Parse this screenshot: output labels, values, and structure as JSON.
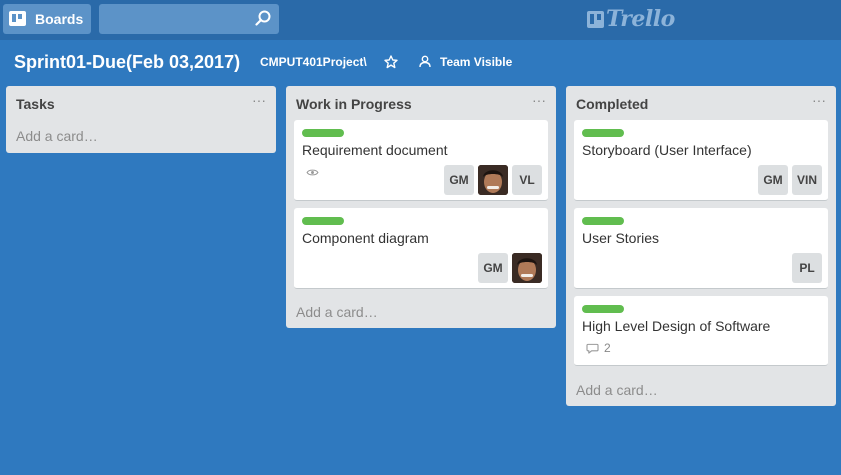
{
  "header": {
    "boards_label": "Boards",
    "search_value": "",
    "logo_text": "Trello"
  },
  "board": {
    "title": "Sprint01-Due(Feb 03,2017)",
    "org": "CMPUT401Project\\",
    "visibility": "Team Visible"
  },
  "lists": [
    {
      "title": "Tasks",
      "menu": "···",
      "add_card": "Add a card…"
    },
    {
      "title": "Work in Progress",
      "menu": "···",
      "add_card": "Add a card…",
      "cards": [
        {
          "title": "Requirement document",
          "members": [
            "GM",
            "VL"
          ]
        },
        {
          "title": "Component diagram",
          "members": [
            "GM"
          ]
        }
      ]
    },
    {
      "title": "Completed",
      "menu": "···",
      "add_card": "Add a card…",
      "cards": [
        {
          "title": "Storyboard (User Interface)",
          "members": [
            "GM",
            "VIN"
          ]
        },
        {
          "title": "User Stories",
          "members": [
            "PL"
          ]
        },
        {
          "title": "High Level Design of Software",
          "comments": "2"
        }
      ]
    }
  ],
  "colors": {
    "background": "#2f79bf",
    "topbar": "#2a6aa9",
    "label_green": "#61bd4f",
    "list_bg": "#e2e4e6"
  },
  "icons": {
    "boards": "boards-icon",
    "search": "search-icon",
    "star": "star-icon",
    "visibility": "team-icon",
    "watch": "eye-icon",
    "comment": "comment-icon"
  }
}
